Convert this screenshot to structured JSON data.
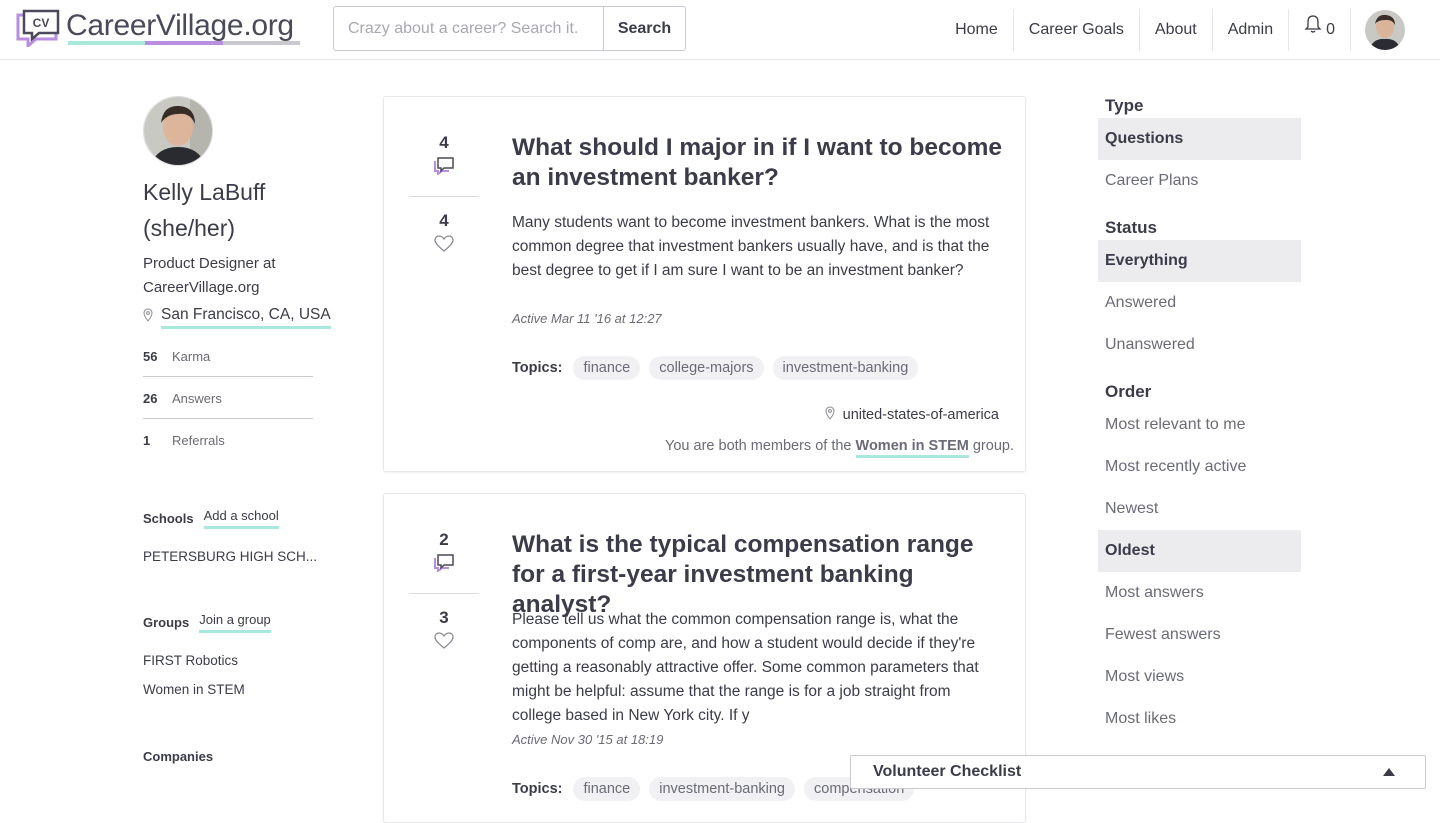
{
  "brand": {
    "logo_text": "CareerVillage.org",
    "logo_mark_text": "CV",
    "colors": {
      "purple": "#b98ee0",
      "teal": "#a9e8dc",
      "gray": "#c9c9cf"
    }
  },
  "search": {
    "placeholder": "Crazy about a career? Search it.",
    "value": "",
    "button_label": "Search"
  },
  "nav": {
    "items": [
      "Home",
      "Career Goals",
      "About",
      "Admin"
    ],
    "notifications_count": "0"
  },
  "profile": {
    "name_line1": "Kelly LaBuff",
    "name_line2": "(she/her)",
    "title_line1": "Product Designer at",
    "title_line2": "CareerVillage.org",
    "location": "San Francisco, CA, USA",
    "stats": [
      {
        "num": "56",
        "label": "Karma"
      },
      {
        "num": "26",
        "label": "Answers"
      },
      {
        "num": "1",
        "label": "Referrals"
      }
    ],
    "schools_label": "Schools",
    "add_school_label": "Add a school",
    "school": "PETERSBURG HIGH SCH...",
    "groups_label": "Groups",
    "join_group_label": "Join a group",
    "groups": [
      "FIRST Robotics",
      "Women in STEM"
    ],
    "companies_label": "Companies"
  },
  "questions": [
    {
      "answers": "4",
      "likes": "4",
      "title": "What should I major in if I want to become an investment banker?",
      "body": "Many students want to become investment bankers. What is the most common degree that investment bankers usually have, and is that the best degree to get if I am sure I want to be an investment banker?",
      "active": "Active Mar 11 '16 at 12:27",
      "topics_label": "Topics:",
      "topics": [
        "finance",
        "college-majors",
        "investment-banking"
      ],
      "location": "united-states-of-america",
      "group_prefix": "You are both members of the ",
      "group_name": "Women in STEM",
      "group_suffix": " group."
    },
    {
      "answers": "2",
      "likes": "3",
      "title": "What is the typical compensation range for a first-year investment banking analyst?",
      "body": "Please tell us what the common compensation range is, what the components of comp are, and how a student would decide if they're getting a reasonably attractive offer. Some common parameters that might be helpful: assume that the range is for a job straight from college based in New York city. If y",
      "active": "Active Nov 30 '15 at 18:19",
      "topics_label": "Topics:",
      "topics": [
        "finance",
        "investment-banking",
        "compensation"
      ]
    }
  ],
  "filters": {
    "type_label": "Type",
    "type_items": [
      "Questions",
      "Career Plans"
    ],
    "status_label": "Status",
    "status_items": [
      "Everything",
      "Answered",
      "Unanswered"
    ],
    "order_label": "Order",
    "order_items": [
      "Most relevant to me",
      "Most recently active",
      "Newest",
      "Oldest",
      "Most answers",
      "Fewest answers",
      "Most views",
      "Most likes"
    ],
    "selected": {
      "type": "Questions",
      "status": "Everything",
      "order": "Oldest"
    }
  },
  "checklist": {
    "title": "Volunteer Checklist"
  }
}
